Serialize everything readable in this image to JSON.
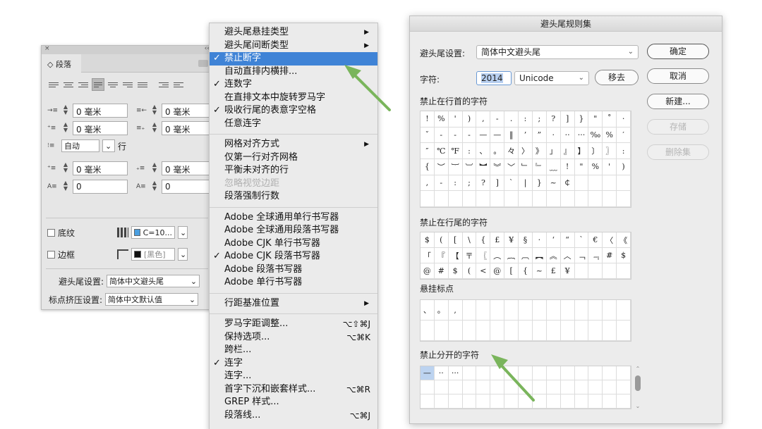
{
  "paragraph_panel": {
    "close": "×",
    "collapse": "‹‹",
    "tab_label": "◇ 段落",
    "fields": [
      {
        "value": "0 毫米"
      },
      {
        "value": "0 毫米"
      },
      {
        "value": "0 毫米"
      },
      {
        "value": "0 毫米"
      },
      {
        "value": "0 毫米"
      },
      {
        "value": "0 毫米"
      },
      {
        "value": "0"
      },
      {
        "value": "0"
      }
    ],
    "leading_value": "自动",
    "leading_unit": "行",
    "shading_label": "底纹",
    "shading_color": "C=10...",
    "border_label": "边框",
    "border_color": "[黑色]",
    "kinsoku_label": "避头尾设置:",
    "kinsoku_value": "简体中文避头尾",
    "mojikumi_label": "标点挤压设置:",
    "mojikumi_value": "简体中文默认值"
  },
  "menu": {
    "items": [
      {
        "label": "避头尾悬挂类型",
        "arrow": "▶"
      },
      {
        "label": "避头尾间断类型",
        "arrow": "▶"
      },
      {
        "label": "禁止断字",
        "check": "✓",
        "highlight": true
      },
      {
        "label": "自动直排内横排..."
      },
      {
        "label": "连数字",
        "check": "✓"
      },
      {
        "label": "在直排文本中旋转罗马字"
      },
      {
        "label": "吸收行尾的表意字空格",
        "check": "✓"
      },
      {
        "label": "任意连字"
      },
      {
        "sep": true
      },
      {
        "label": "网格对齐方式",
        "arrow": "▶"
      },
      {
        "label": "仅第一行对齐网格"
      },
      {
        "label": "平衡未对齐的行"
      },
      {
        "label": "忽略视觉边距",
        "disabled": true
      },
      {
        "label": "段落强制行数"
      },
      {
        "sep": true
      },
      {
        "label": "Adobe 全球通用单行书写器"
      },
      {
        "label": "Adobe 全球通用段落书写器"
      },
      {
        "label": "Adobe CJK 单行书写器"
      },
      {
        "label": "Adobe CJK 段落书写器",
        "check": "✓"
      },
      {
        "label": "Adobe 段落书写器"
      },
      {
        "label": "Adobe 单行书写器"
      },
      {
        "sep": true
      },
      {
        "label": "行距基准位置",
        "arrow": "▶"
      },
      {
        "sep": true
      },
      {
        "label": "罗马字距调整...",
        "shortcut": "⌥⇧⌘J"
      },
      {
        "label": "保持选项...",
        "shortcut": "⌥⌘K"
      },
      {
        "label": "跨栏..."
      },
      {
        "label": "连字",
        "check": "✓"
      },
      {
        "label": "连字..."
      },
      {
        "label": "首字下沉和嵌套样式...",
        "shortcut": "⌥⌘R"
      },
      {
        "label": "GREP 样式..."
      },
      {
        "label": "段落线...",
        "shortcut": "⌥⌘J"
      }
    ]
  },
  "dialog": {
    "title": "避头尾规则集",
    "setting_label": "避头尾设置:",
    "setting_value": "简体中文避头尾",
    "char_label": "字符:",
    "char_value": "2014",
    "encoding": "Unicode",
    "remove_button": "移去",
    "ok_button": "确定",
    "cancel_button": "取消",
    "new_button": "新建...",
    "save_button": "存储",
    "delete_button": "删除集",
    "section1_title": "禁止在行首的字符",
    "section1_chars": [
      "!",
      "%",
      "'",
      ")",
      ",",
      "-",
      ".",
      ":",
      ";",
      "?",
      "]",
      "}",
      "\"",
      "˚",
      "·",
      "ˇ",
      "-",
      "-",
      "-",
      "—",
      "—",
      "‖",
      "’",
      "”",
      "·",
      "··",
      "···",
      "‰",
      "%",
      "′",
      "″",
      "℃",
      "℉",
      ":",
      "、",
      "。",
      "々",
      "〉",
      "》",
      "」",
      "』",
      "】",
      "〕",
      "〗",
      ":",
      "{",
      "︶",
      "︸",
      "︺",
      "︼",
      "︾",
      "﹀",
      "﹂",
      "﹄",
      "﹏",
      "!",
      "\"",
      "%",
      "'",
      ")",
      ",",
      "-",
      ":",
      ";",
      "?",
      "]",
      "`",
      "|",
      "}",
      "~",
      "￠",
      "",
      "",
      "",
      ""
    ],
    "section2_title": "禁止在行尾的字符",
    "section2_chars": [
      "$",
      "(",
      "[",
      "\\",
      "{",
      "£",
      "¥",
      "§",
      "·",
      "‘",
      "“",
      "`",
      "€",
      "〈",
      "《",
      "「",
      "『",
      "【",
      "〒",
      "〖",
      "︵",
      "︷",
      "︹",
      "︻",
      "︽",
      "︿",
      "﹁",
      "﹃",
      "#",
      "$",
      "@",
      "#",
      "$",
      "(",
      "<",
      "@",
      "[",
      "{",
      "~",
      "£",
      "¥",
      "",
      "",
      "",
      ""
    ],
    "section3_title": "悬挂标点",
    "section3_chars": [
      "、",
      "。",
      ","
    ],
    "section4_title": "禁止分开的字符",
    "section4_chars": [
      "—",
      "··",
      "···"
    ]
  },
  "colors": {
    "menu_highlight": "#3f83d6",
    "arrow": "#7ab55c",
    "selection": "#bcd3f0"
  }
}
